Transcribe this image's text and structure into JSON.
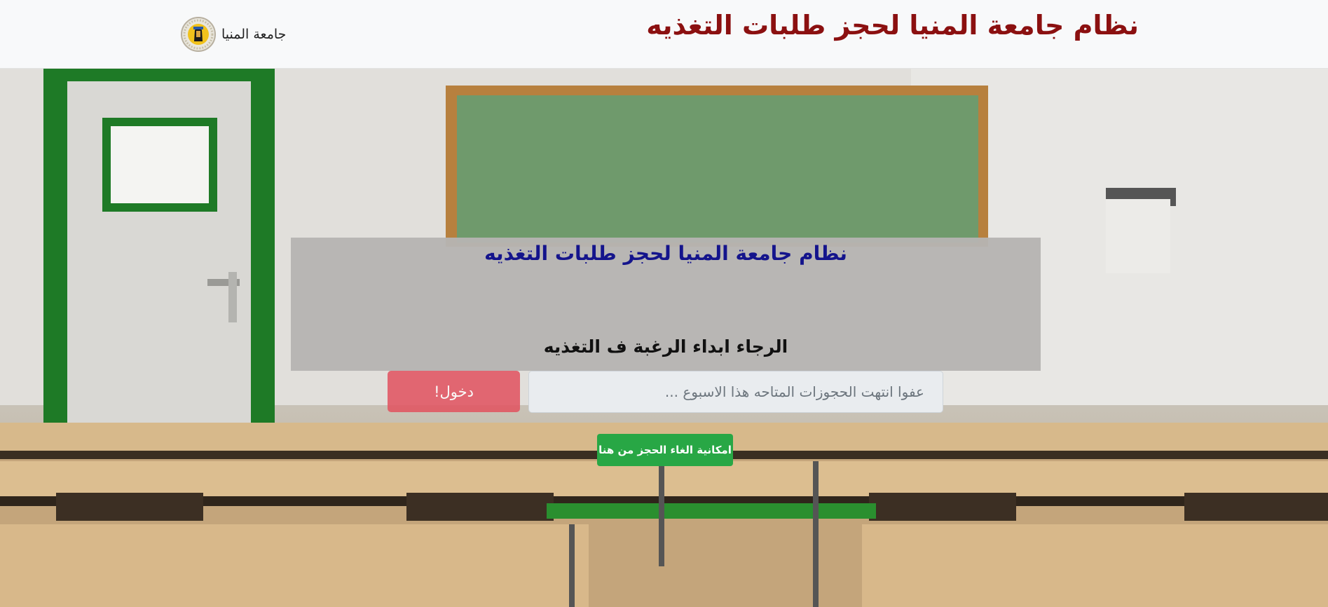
{
  "header": {
    "brand_label": "جامعة المنيا",
    "brand_icon": "university-logo-icon",
    "title": "نظام جامعة المنيا لحجز طلبات التغذيه",
    "title_color": "#8b1010"
  },
  "panel": {
    "title": "نظام جامعة المنيا لحجز طلبات التغذيه",
    "title_color": "#14148c",
    "prompt": "الرجاء ابداء الرغبة ف التغذيه"
  },
  "form": {
    "message_placeholder": "عفوا انتهت الحجوزات المتاحه هذا الاسبوع ...",
    "login_label": "دخول!",
    "login_color": "#e2525f"
  },
  "cancel": {
    "label": "امكانية الغاء الحجز من هنا",
    "color": "#28a745"
  }
}
